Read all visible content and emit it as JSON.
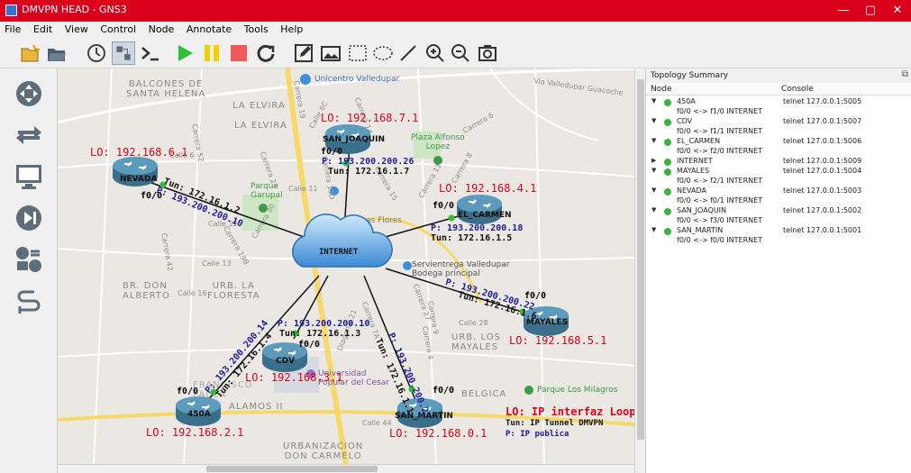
{
  "window": {
    "title": "DMVPN HEAD - GNS3",
    "minimize": "—",
    "maximize": "▢",
    "close": "✕"
  },
  "menu": [
    "File",
    "Edit",
    "View",
    "Control",
    "Node",
    "Annotate",
    "Tools",
    "Help"
  ],
  "toolbar": {
    "icons": [
      "new-project-icon",
      "open-project-icon",
      "snapshot-icon",
      "show-interface-labels-icon",
      "console-all-icon",
      "start-all-icon",
      "suspend-all-icon",
      "stop-all-icon",
      "reload-all-icon",
      "add-note-icon",
      "insert-picture-icon",
      "draw-rectangle-icon",
      "draw-ellipse-icon",
      "draw-line-icon",
      "zoom-in-icon",
      "zoom-out-icon",
      "screenshot-icon"
    ]
  },
  "leftbar": {
    "icons": [
      "browse-routers-icon",
      "browse-switches-icon",
      "browse-end-devices-icon",
      "browse-security-devices-icon",
      "browse-all-devices-icon",
      "add-link-icon"
    ]
  },
  "map_labels": {
    "balcones": "BALCONES DE\nSANTA HELENA",
    "elvira1": "LA ELVIRA",
    "elvira2": "LA ELVIRA",
    "unicentro": "Unicentro Valledupar",
    "via_valledupar": "Via Valledupar Guacoche",
    "plaza": "Plaza Alfonso\nLopez",
    "parque_garupal": "Parque\nGarupal",
    "las_flores": "Las Flores",
    "servientrega": "Servientrega Valledupar\nBodega principal",
    "br_don_alberto": "BR. DON\nALBERTO",
    "urb_floresta": "URB. LA\nFLORESTA",
    "urb_mayales": "URB. LOS\nMAYALES",
    "universidad": "Universidad\nPopular del Cesar",
    "belgica": "BELGICA",
    "parque_milagros": "Parque Los Milagros",
    "alamos": "ALAMOS II",
    "urbanizacion": "URBANIZACION\nDON CARMELO",
    "francisco": "FRANCISCO\nPAULA",
    "carrera19": "Carrera 19",
    "calle44": "Calle 44",
    "calle11": "Calle 11",
    "calle12": "Calle 12",
    "calle28": "Calle 28",
    "calle16": "Calle 16",
    "calle6": "Calle 6",
    "calle6c": "Calle 6C",
    "carrera52": "Carrera 52",
    "carrera23": "Carrera 23",
    "carrera42": "Carrera 42",
    "carrera30": "Carrera 30",
    "carrera8": "Carrera 8",
    "carrera11": "Carrera 11",
    "carrera15": "Carrera 15",
    "carrera19d": "Carrera 19D",
    "carrera14": "Carrera 14",
    "carrera6": "Carrera 6",
    "carrera27": "Carrera 27",
    "carrera4": "Carrera 4",
    "carrera19b": "Carrera 19B",
    "diagonal": "Diagonal 21",
    "carrera7a": "Carrera 7A",
    "carrera9": "Carrera 9",
    "calle_13": "Calle 13"
  },
  "nodes": {
    "internet": {
      "name": "INTERNET"
    },
    "nevada": {
      "name": "NEVADA",
      "lo": "LO: 192.168.6.1",
      "iface": "f0/0",
      "p": "P: 193.200.200.10",
      "tun": "Tun: 172.16.1.2"
    },
    "san_joaquin": {
      "name": "SAN_JOAQUIN",
      "lo": "LO: 192.168.7.1",
      "iface": "f0/0",
      "p": "P: 193.200.200.26",
      "tun": "Tun: 172.16.1.7"
    },
    "el_carmen": {
      "name": "EL_CARMEN",
      "lo": "LO: 192.168.4.1",
      "iface": "f0/0",
      "p": "P: 193.200.200.18",
      "tun": "Tun: 172.16.1.5"
    },
    "mayales": {
      "name": "MAYALES",
      "lo": "LO: 192.168.5.1",
      "iface": "f0/0",
      "p": "P: 193.200.200.22",
      "tun": "Tun: 172.16.1.6"
    },
    "cdv": {
      "name": "CDV",
      "lo": "LO: 192.168.3.1",
      "iface": "f0/0",
      "p": "P: 193.200.200.10",
      "tun": "Tun: 172.16.1.3"
    },
    "a450": {
      "name": "450A",
      "lo": "LO: 192.168.2.1",
      "iface": "f0/0",
      "p": "P: 193.200.200.14",
      "tun": "Tun: 172.16.1.4"
    },
    "san_martin": {
      "name": "SAN_MARTIN",
      "lo": "LO: 192.168.0.1",
      "iface": "f0/0",
      "p": "P: 193.200.200.2",
      "tun": "Tun: 172.16.1.1"
    }
  },
  "legend": {
    "lo": "LO: IP interfaz Loopback",
    "tun": "Tun: IP Tunnel DMVPN",
    "p": "P: IP publica"
  },
  "summary": {
    "title": "Topology Summary",
    "col_node": "Node",
    "col_console": "Console",
    "rows": [
      {
        "name": "450A",
        "console": "telnet 127.0.0.1:5005",
        "link": "f0/0 <-> f1/0 INTERNET",
        "expanded": true
      },
      {
        "name": "CDV",
        "console": "telnet 127.0.0.1:5007",
        "link": "f0/0 <-> f1/1 INTERNET",
        "expanded": true
      },
      {
        "name": "EL_CARMEN",
        "console": "telnet 127.0.0.1:5006",
        "link": "f0/0 <-> f2/0 INTERNET",
        "expanded": true
      },
      {
        "name": "INTERNET",
        "console": "telnet 127.0.0.1:5009",
        "link": "",
        "expanded": false
      },
      {
        "name": "MAYALES",
        "console": "telnet 127.0.0.1:5004",
        "link": "f0/0 <-> f2/1 INTERNET",
        "expanded": true
      },
      {
        "name": "NEVADA",
        "console": "telnet 127.0.0.1:5003",
        "link": "f0/0 <-> f0/1 INTERNET",
        "expanded": true
      },
      {
        "name": "SAN_JOAQUIN",
        "console": "telnet 127.0.0.1:5002",
        "link": "f0/0 <-> f3/0 INTERNET",
        "expanded": true
      },
      {
        "name": "SAN_MARTIN",
        "console": "telnet 127.0.0.1:5001",
        "link": "f0/0 <-> f0/0 INTERNET",
        "expanded": true
      }
    ]
  }
}
